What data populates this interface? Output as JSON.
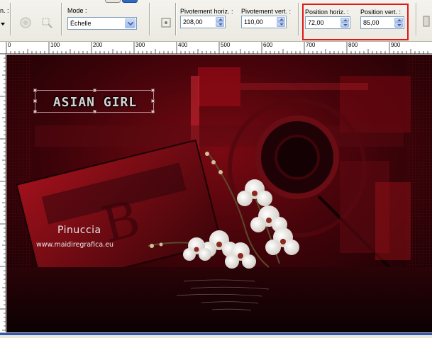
{
  "toolbar": {
    "partial_label": "n. :",
    "mode_label": "Mode :",
    "mode_value": "Échelle",
    "fields": [
      {
        "label": "Pivotement horiz. :",
        "value": "208,00"
      },
      {
        "label": "Pivotement vert. :",
        "value": "110,00"
      },
      {
        "label": "Position horiz. :",
        "value": "72,00"
      },
      {
        "label": "Position vert. :",
        "value": "85,00"
      }
    ],
    "highlight_color": "#e01818"
  },
  "ruler": {
    "ticks": [
      "0",
      "100",
      "200",
      "300",
      "400",
      "500",
      "600",
      "700",
      "800",
      "900"
    ]
  },
  "canvas": {
    "title_art": "ASIAN GIRL",
    "watermark_name": "Pinuccia",
    "watermark_url": "www.maidiregrafica.eu",
    "colors": {
      "base": "#220407",
      "accent": "#8e0a14",
      "highlight": "#d42a34"
    }
  }
}
